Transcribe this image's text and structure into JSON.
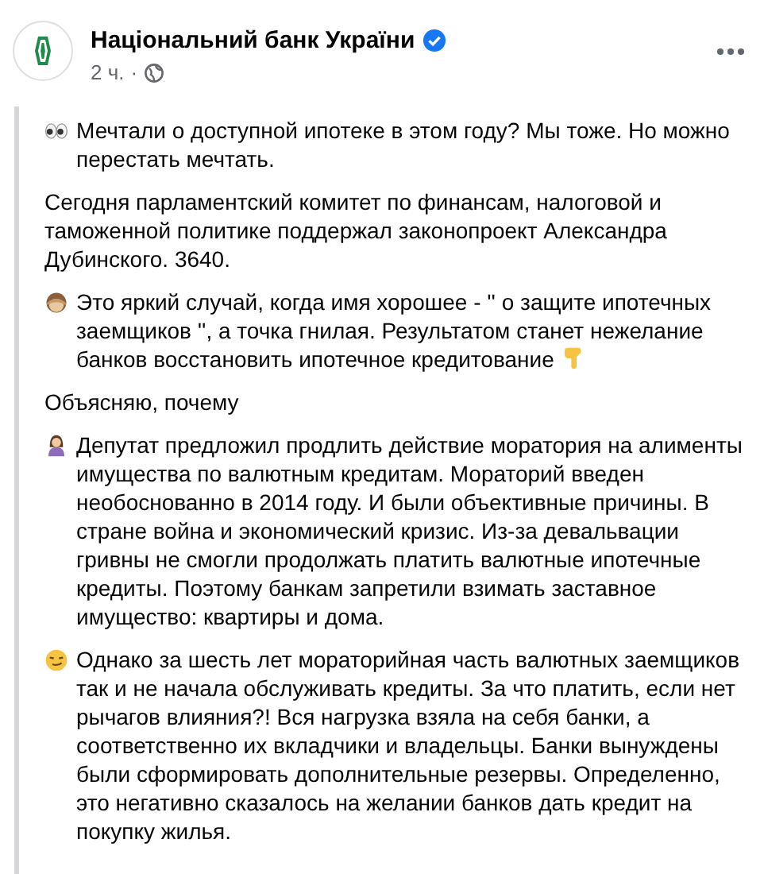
{
  "post": {
    "author": "Національний банк України",
    "verified": true,
    "time": "2 ч.",
    "separator": "·",
    "paragraphs": [
      {
        "kind": "eyes",
        "text": "Мечтали о доступной ипотеке в этом году? Мы тоже. Но можно перестать мечтать."
      },
      {
        "kind": "plain",
        "text": "Сегодня парламентский комитет по финансам, налоговой и таможенной политике поддержал законопроект Александра Дубинского. 3640."
      },
      {
        "kind": "monkey",
        "text": "Это яркий случай, когда имя хорошее - '' о защите ипотечных заемщиков '', а точка гнилая. Результатом станет нежелание банков восстановить ипотечное кредитование",
        "ends_with_icon": true
      },
      {
        "kind": "plain",
        "text": "Объясняю, почему"
      },
      {
        "kind": "woman",
        "text": "Депутат предложил продлить действие моратория на алименты имущества по валютным кредитам. Мораторий введен необоснованно в 2014 году. И были объективные причины. В стране война и экономический кризис. Из-за девальвации гривны не смогли продолжать платить валютные ипотечные кредиты. Поэтому банкам запретили взимать заставное имущество: квартиры и дома."
      },
      {
        "kind": "smirk",
        "text": "Однако за шесть лет мораторийная часть валютных заемщиков так и не начала обслуживать кредиты. За что платить, если нет рычагов влияния?! Вся нагрузка взяла на себя банки, а соответственно их вкладчики и владельцы. Банки вынуждены были сформировать дополнительные резервы. Определенно, это негативно сказалось на желании банков дать кредит на покупку жилья."
      }
    ]
  }
}
